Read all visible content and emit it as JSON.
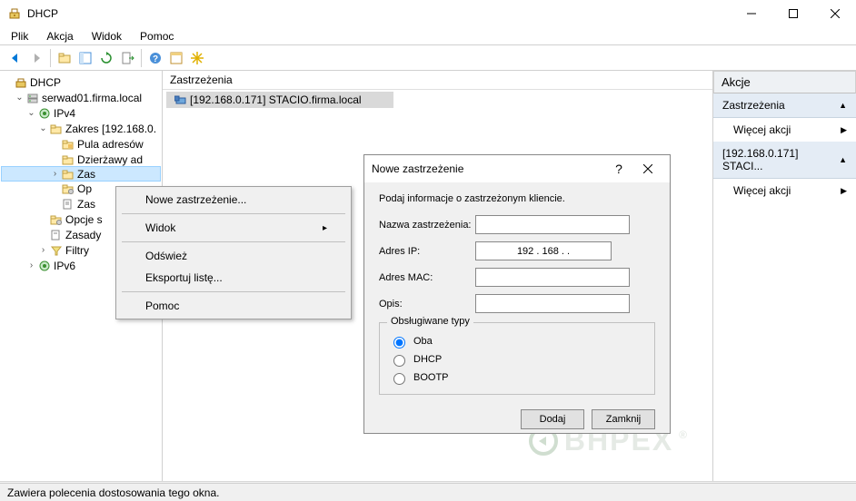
{
  "window": {
    "title": "DHCP"
  },
  "menu": {
    "plik": "Plik",
    "akcja": "Akcja",
    "widok": "Widok",
    "pomoc": "Pomoc"
  },
  "tree": {
    "root": "DHCP",
    "server": "serwad01.firma.local",
    "ipv4": "IPv4",
    "scope": "Zakres [192.168.0.",
    "pool": "Pula adresów",
    "leases": "Dzierżawy ad",
    "reservations": "Zas",
    "opt1": "Op",
    "res2": "Zas",
    "optscope": "Opcje s",
    "policies": "Zasady",
    "filters": "Filtry",
    "ipv6": "IPv6"
  },
  "center": {
    "header": "Zastrzeżenia",
    "item1": "[192.168.0.171] STACIO.firma.local"
  },
  "ctx": {
    "new": "Nowe zastrzeżenie...",
    "widok": "Widok",
    "refresh": "Odśwież",
    "export": "Eksportuj listę...",
    "pomoc": "Pomoc"
  },
  "dialog": {
    "title": "Nowe zastrzeżenie",
    "subtitle": "Podaj informacje o zastrzeżonym kliencie.",
    "name_lbl": "Nazwa zastrzeżenia:",
    "ip_lbl": "Adres IP:",
    "ip_val": "192 . 168 .        .",
    "mac_lbl": "Adres MAC:",
    "desc_lbl": "Opis:",
    "types_lbl": "Obsługiwane typy",
    "oba": "Oba",
    "dhcp": "DHCP",
    "bootp": "BOOTP",
    "add": "Dodaj",
    "close": "Zamknij"
  },
  "actions": {
    "header": "Akcje",
    "reservations": "Zastrzeżenia",
    "more": "Więcej akcji",
    "item": "[192.168.0.171] STACI...",
    "more2": "Więcej akcji"
  },
  "status": "Zawiera polecenia dostosowania tego okna.",
  "watermark": "BHPEX"
}
